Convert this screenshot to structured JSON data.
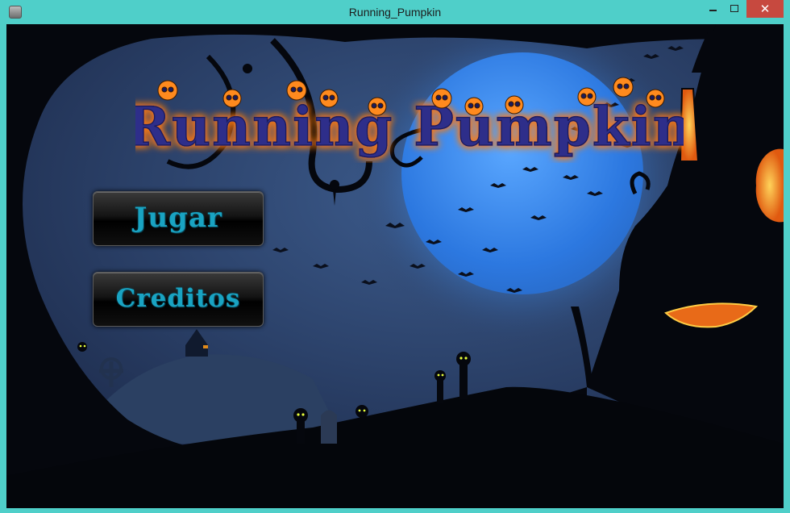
{
  "window": {
    "title": "Running_Pumpkin",
    "close_glyph": "✕"
  },
  "game": {
    "logo_text": "Running Pumpkin",
    "menu": {
      "play_label": "Jugar",
      "credits_label": "Creditos"
    }
  },
  "colors": {
    "window_frame": "#4fcfc9",
    "close_button": "#c7493f",
    "sky": "#2a3f66",
    "moon": "#3d86e8",
    "logo_fill": "#2d2f8a",
    "logo_glow": "#ff7a14",
    "button_text": "#19a3c2"
  },
  "icons": [
    "app-icon",
    "minimize-icon",
    "maximize-icon",
    "close-icon",
    "skull-icon"
  ]
}
